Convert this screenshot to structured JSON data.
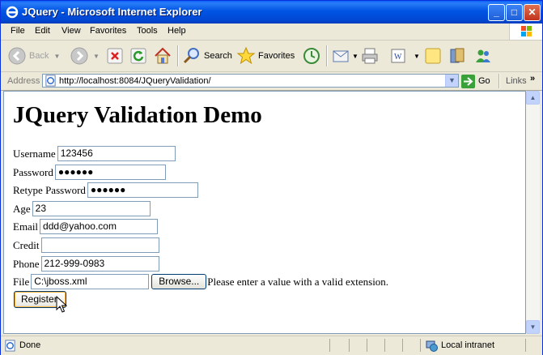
{
  "window": {
    "title": "JQuery - Microsoft Internet Explorer"
  },
  "menu": [
    "File",
    "Edit",
    "View",
    "Favorites",
    "Tools",
    "Help"
  ],
  "toolbar": {
    "back_label": "Back",
    "search_label": "Search",
    "favorites_label": "Favorites",
    "links_label": "Links",
    "go_label": "Go"
  },
  "address": {
    "label": "Address",
    "url": "http://localhost:8084/JQueryValidation/"
  },
  "page": {
    "heading": "JQuery Validation Demo",
    "fields": {
      "username": {
        "label": "Username",
        "value": "123456"
      },
      "password": {
        "label": "Password",
        "value": "●●●●●●"
      },
      "retype_password": {
        "label": "Retype Password",
        "value": "●●●●●●"
      },
      "age": {
        "label": "Age",
        "value": "23"
      },
      "email": {
        "label": "Email",
        "value": "ddd@yahoo.com"
      },
      "credit": {
        "label": "Credit",
        "value": ""
      },
      "phone": {
        "label": "Phone",
        "value": "212-999-0983"
      },
      "file": {
        "label": "File",
        "value": "C:\\jboss.xml",
        "browse_label": "Browse...",
        "error": "Please enter a value with a valid extension."
      }
    },
    "register_label": "Register"
  },
  "status": {
    "text": "Done",
    "zone": "Local intranet"
  }
}
